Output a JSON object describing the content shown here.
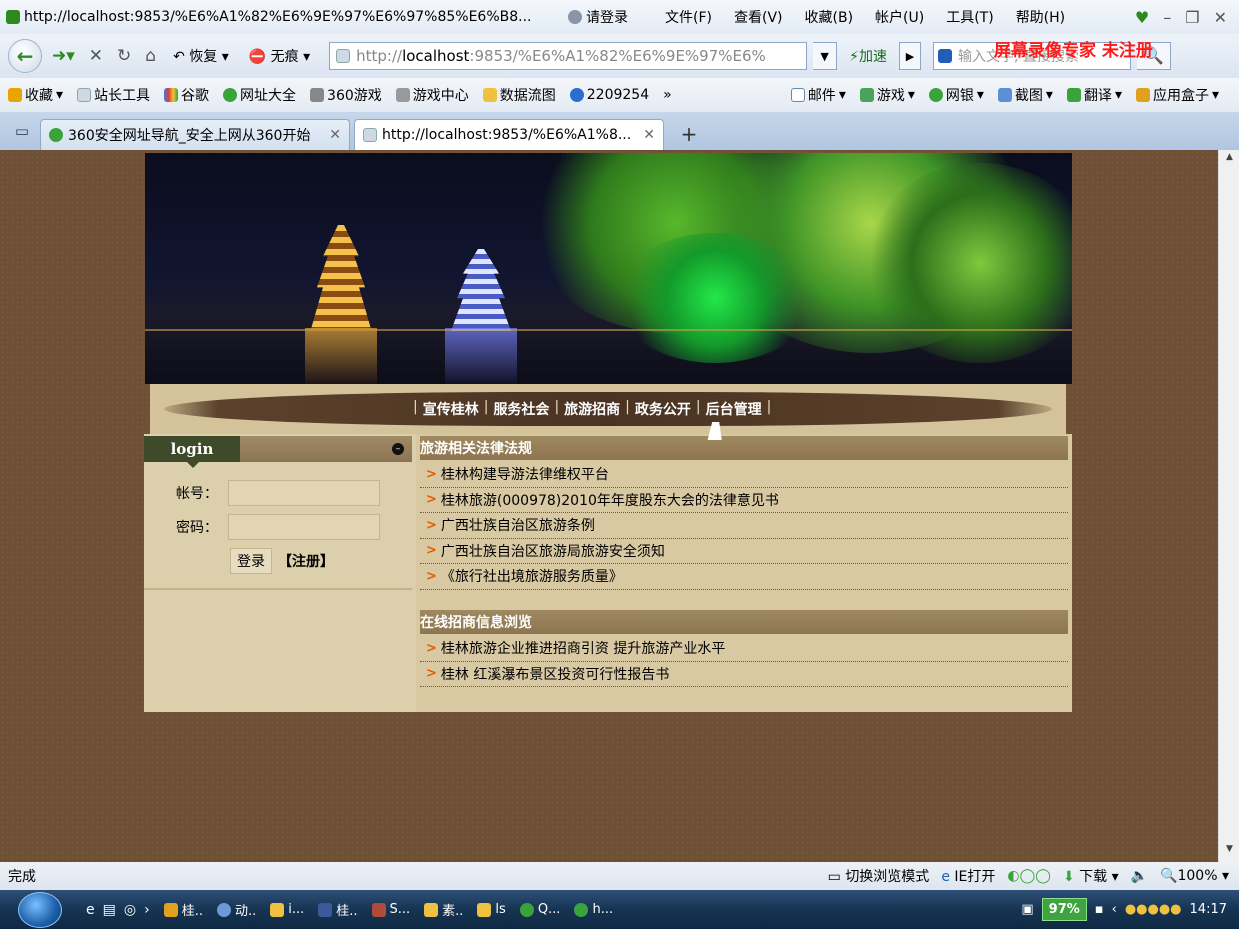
{
  "browser": {
    "title_url": "http://localhost:9853/%E6%A1%82%E6%9E%97%E6%97%85%E6%B8...",
    "login_prompt": "请登录",
    "menu": [
      "文件(F)",
      "查看(V)",
      "收藏(B)",
      "帐户(U)",
      "工具(T)",
      "帮助(H)"
    ],
    "restore_label": "恢复",
    "incognito_label": "无痕",
    "address_host": "localhost",
    "address_prefix": "http://",
    "address_rest": ":9853/%E6%A1%82%E6%9E%97%E6%",
    "speed_label": "加速",
    "search_placeholder": "输入文字, 直接搜索",
    "watermark": "屏幕录像专家 未注册",
    "favorites": [
      "收藏",
      "站长工具",
      "谷歌",
      "网址大全",
      "360游戏",
      "游戏中心",
      "数据流图",
      "2209254"
    ],
    "favorites_more": "»",
    "favorites_right": [
      "邮件",
      "游戏",
      "网银",
      "截图",
      "翻译",
      "应用盒子"
    ],
    "tabs": [
      {
        "label": "360安全网址导航_安全上网从360开始"
      },
      {
        "label": "http://localhost:9853/%E6%A1%8..."
      }
    ]
  },
  "site": {
    "nav": [
      "宣传桂林",
      "服务社会",
      "旅游招商",
      "政务公开",
      "后台管理"
    ],
    "login": {
      "tab": "login",
      "account_label": "帐号：",
      "password_label": "密码：",
      "submit": "登录",
      "register": "【注册】"
    },
    "sections": [
      {
        "title": "旅游相关法律法规",
        "items": [
          "桂林构建导游法律维权平台",
          "桂林旅游(000978)2010年年度股东大会的法律意见书",
          "广西壮族自治区旅游条例",
          "广西壮族自治区旅游局旅游安全须知",
          "《旅行社出境旅游服务质量》"
        ]
      },
      {
        "title": "在线招商信息浏览",
        "items": [
          "桂林旅游企业推进招商引资 提升旅游产业水平",
          "桂林 红溪瀑布景区投资可行性报告书"
        ]
      }
    ]
  },
  "status": {
    "left": "完成",
    "switch_mode": "切换浏览模式",
    "ie_open": "IE打开",
    "download": "下载",
    "zoom": "100%"
  },
  "taskbar": {
    "items": [
      "桂..",
      "动..",
      "i...",
      "桂..",
      "S...",
      "素..",
      "ls",
      "Q...",
      "h..."
    ],
    "battery": "97%",
    "clock": "14:17"
  },
  "colors": {
    "page_bg": "#6e5036",
    "content_bg": "#d8c9a3",
    "section_head": "#8c7550",
    "arrow": "#e85a00",
    "login_tab": "#3f4a2a"
  }
}
